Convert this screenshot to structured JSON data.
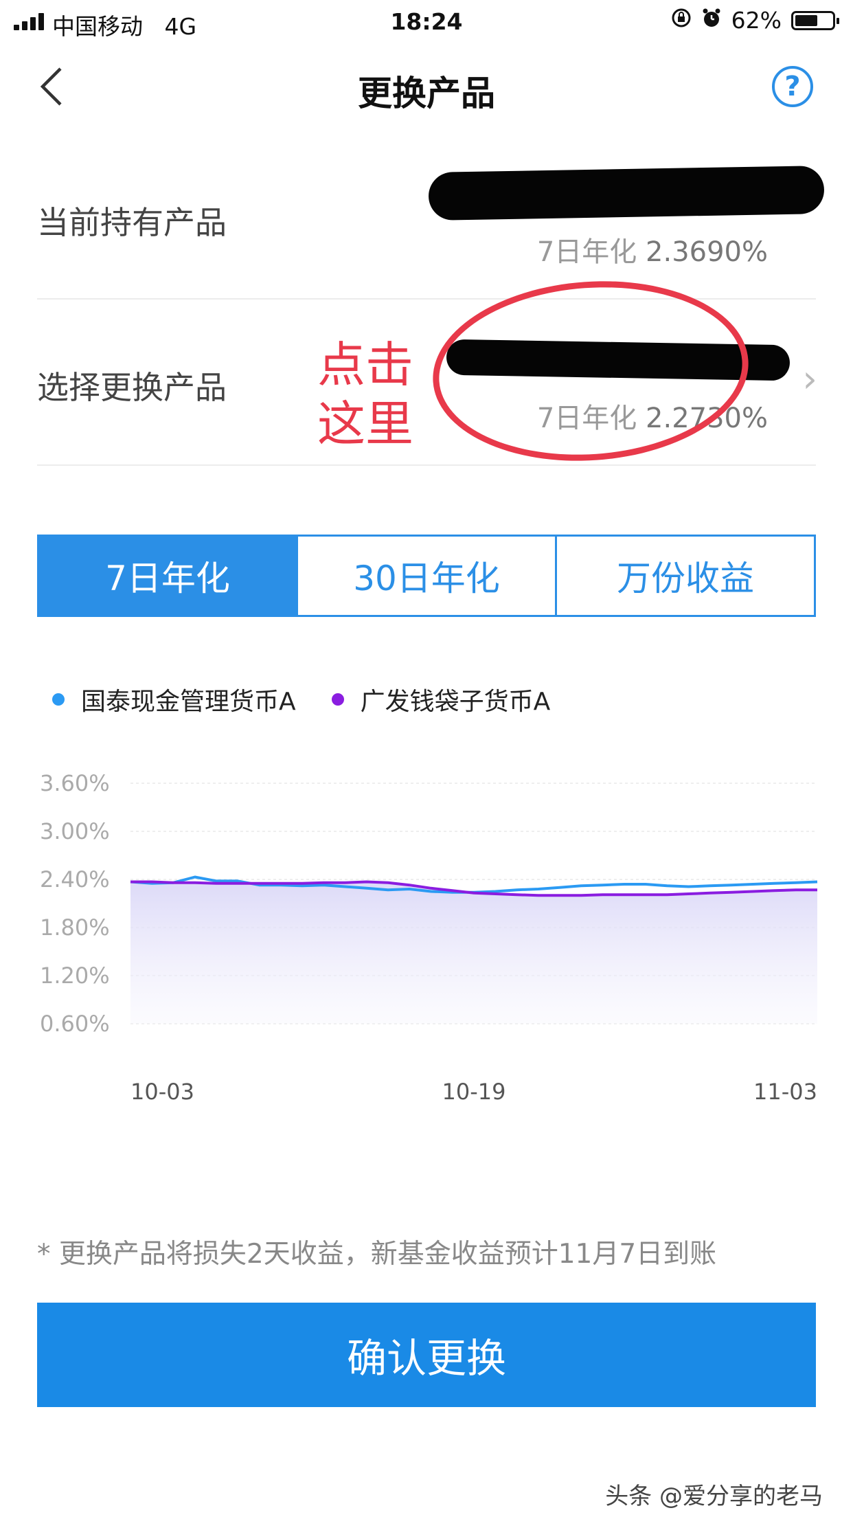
{
  "status_bar": {
    "carrier": "中国移动",
    "network": "4G",
    "time": "18:24",
    "battery": "62%",
    "battery_level": 0.62
  },
  "nav": {
    "back_icon": "chevron-left-icon",
    "title": "更换产品",
    "help_icon": "question-icon",
    "help_glyph": "?"
  },
  "current_product": {
    "label": "当前持有产品",
    "rate_label": "7日年化",
    "rate_value": "2.3690%"
  },
  "select_product": {
    "label": "选择更换产品",
    "rate_label": "7日年化",
    "rate_value": "2.2730%",
    "chevron_glyph": "›"
  },
  "annotation": {
    "line1": "点击",
    "line2": "这里",
    "color": "#e8394a"
  },
  "tabs": [
    {
      "label": "7日年化",
      "active": true
    },
    {
      "label": "30日年化",
      "active": false
    },
    {
      "label": "万份收益",
      "active": false
    }
  ],
  "colors": {
    "accent": "#2b8fe6",
    "button": "#1a8ae6",
    "series_1": "#2b9af3",
    "series_2": "#8a1de0"
  },
  "chart_data": {
    "type": "line",
    "title": "",
    "y_ticks": [
      "3.60%",
      "3.00%",
      "2.40%",
      "1.80%",
      "1.20%",
      "0.60%"
    ],
    "ylim": [
      0.6,
      3.6
    ],
    "x_ticks": [
      "10-03",
      "10-19",
      "11-03"
    ],
    "grid": true,
    "legend_position": "top-left",
    "series": [
      {
        "name": "国泰现金管理货币A",
        "color": "#2b9af3",
        "values": [
          2.37,
          2.35,
          2.36,
          2.43,
          2.38,
          2.38,
          2.33,
          2.33,
          2.32,
          2.33,
          2.31,
          2.29,
          2.27,
          2.28,
          2.25,
          2.24,
          2.24,
          2.25,
          2.27,
          2.28,
          2.3,
          2.32,
          2.33,
          2.34,
          2.34,
          2.32,
          2.31,
          2.32,
          2.33,
          2.34,
          2.35,
          2.36,
          2.37
        ]
      },
      {
        "name": "广发钱袋子货币A",
        "color": "#8a1de0",
        "values": [
          2.37,
          2.37,
          2.36,
          2.36,
          2.35,
          2.35,
          2.35,
          2.35,
          2.35,
          2.36,
          2.36,
          2.37,
          2.36,
          2.33,
          2.29,
          2.26,
          2.23,
          2.22,
          2.21,
          2.2,
          2.2,
          2.2,
          2.21,
          2.21,
          2.21,
          2.21,
          2.22,
          2.23,
          2.24,
          2.25,
          2.26,
          2.27,
          2.27
        ]
      }
    ]
  },
  "footer": {
    "note": "* 更换产品将损失2天收益，新基金收益预计11月7日到账",
    "confirm_label": "确认更换",
    "watermark": "头条 @爱分享的老马"
  }
}
